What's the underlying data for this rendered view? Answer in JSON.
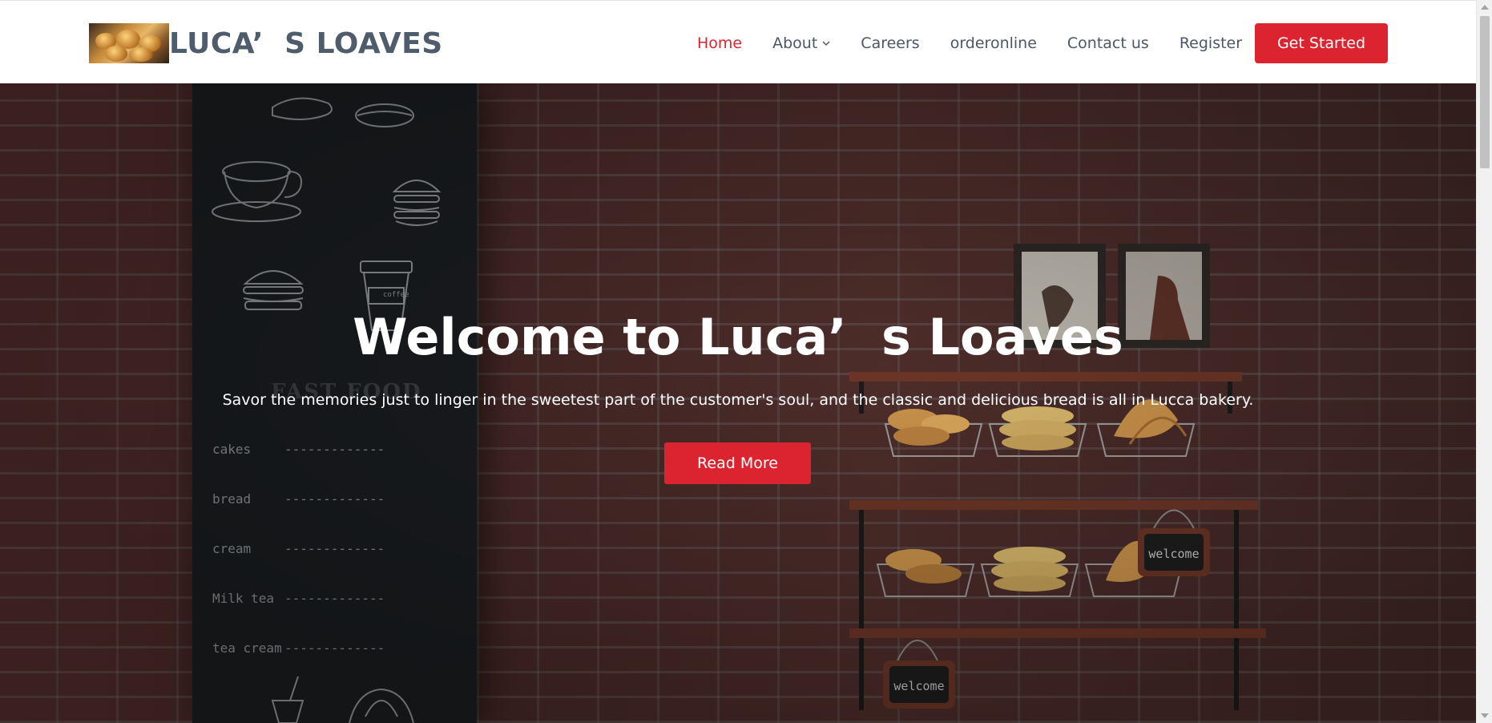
{
  "brand": {
    "name": "LUCA’  S LOAVES",
    "logo_alt": "bread-photo"
  },
  "nav": {
    "items": [
      {
        "label": "Home",
        "active": true
      },
      {
        "label": "About",
        "has_dropdown": true
      },
      {
        "label": "Careers"
      },
      {
        "label": "orderonline"
      },
      {
        "label": "Contact us"
      },
      {
        "label": "Register"
      }
    ],
    "cta_label": "Get Started"
  },
  "hero": {
    "title": "Welcome to Luca’  s Loaves",
    "subtitle": "Savor the memories just to linger in the sweetest part of the customer's soul, and the classic and delicious bread is all in Lucca bakery.",
    "button_label": "Read More",
    "board": {
      "heading": "FAST FOOD",
      "menu": [
        "cakes",
        "bread",
        "cream",
        "Milk tea",
        "tea cream"
      ],
      "dashes": "-------------",
      "cup_label": "coffee"
    },
    "signs": [
      "welcome",
      "welcome"
    ]
  },
  "colors": {
    "accent": "#dc2430",
    "nav_text": "#4b5766",
    "brand_text": "#4e5c6c"
  }
}
